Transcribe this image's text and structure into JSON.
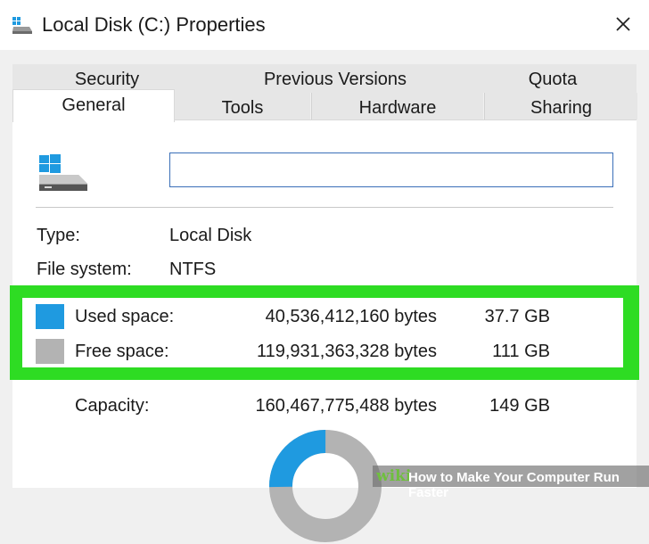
{
  "window": {
    "title": "Local Disk (C:) Properties"
  },
  "tabs": {
    "row1": [
      "Security",
      "Previous Versions",
      "Quota"
    ],
    "row2": [
      "General",
      "Tools",
      "Hardware",
      "Sharing"
    ],
    "active": "General"
  },
  "general": {
    "name_value": "",
    "type_label": "Type:",
    "type_value": "Local Disk",
    "fs_label": "File system:",
    "fs_value": "NTFS",
    "used_label": "Used space:",
    "used_bytes": "40,536,412,160 bytes",
    "used_gb": "37.7 GB",
    "free_label": "Free space:",
    "free_bytes": "119,931,363,328 bytes",
    "free_gb": "111 GB",
    "capacity_label": "Capacity:",
    "capacity_bytes": "160,467,775,488 bytes",
    "capacity_gb": "149 GB"
  },
  "disk_usage": {
    "used_fraction": 0.253,
    "used_color": "#1f9ae0",
    "free_color": "#b3b3b3"
  },
  "highlight_color": "#2edc23",
  "watermark": {
    "brand": "wiki",
    "text": "How to Make Your Computer Run Faster"
  },
  "icons": [
    "drive-icon",
    "close-icon",
    "windows-logo-icon"
  ]
}
